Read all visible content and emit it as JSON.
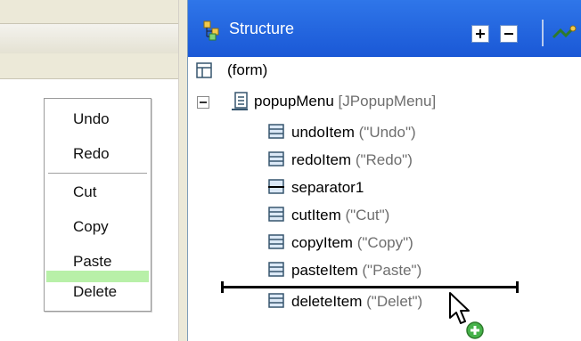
{
  "popup_menu": {
    "items": [
      {
        "label": "Undo"
      },
      {
        "label": "Redo"
      },
      {
        "label": "Cut"
      },
      {
        "label": "Copy"
      },
      {
        "label": "Paste"
      },
      {
        "label": "Delete"
      }
    ]
  },
  "structure": {
    "title": "Structure",
    "toolbar": {
      "expand_icon": "expand-all-icon",
      "collapse_icon": "collapse-all-icon",
      "tool_icon": "connection-tool-icon"
    },
    "tree": [
      {
        "name": "(form)",
        "meta": "",
        "icon": "form-icon"
      },
      {
        "name": "popupMenu",
        "meta": "[JPopupMenu]",
        "icon": "popup-menu-icon",
        "expanded": true
      },
      {
        "name": "undoItem",
        "meta": "(\"Undo\")",
        "icon": "menu-item-icon"
      },
      {
        "name": "redoItem",
        "meta": "(\"Redo\")",
        "icon": "menu-item-icon"
      },
      {
        "name": "separator1",
        "meta": "",
        "icon": "separator-icon"
      },
      {
        "name": "cutItem",
        "meta": "(\"Cut\")",
        "icon": "menu-item-icon"
      },
      {
        "name": "copyItem",
        "meta": "(\"Copy\")",
        "icon": "menu-item-icon"
      },
      {
        "name": "pasteItem",
        "meta": "(\"Paste\")",
        "icon": "menu-item-icon"
      },
      {
        "name": "deleteItem",
        "meta": "(\"Delet",
        "icon": "menu-item-icon"
      }
    ],
    "meta_trail": "\")"
  },
  "colors": {
    "title_bar": "#2468e0",
    "drop_highlight": "#b8f0a8",
    "meta_text": "#6e6e6e"
  }
}
